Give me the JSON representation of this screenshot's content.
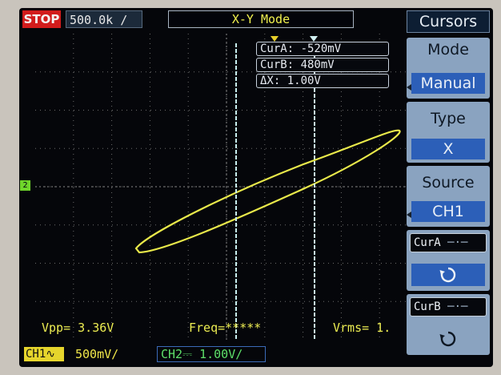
{
  "status": {
    "run_state": "STOP",
    "sample_rate": "500.0k ∕"
  },
  "display": {
    "mode_title": "X-Y    Mode"
  },
  "cursors": {
    "cur_a": "CurA: -520mV",
    "cur_b": "CurB: 480mV",
    "delta": "ΔX: 1.00V"
  },
  "channel_marker": "2",
  "measurements": {
    "vpp": "Vpp= 3.36V",
    "freq": "Freq=*****",
    "vrms": "Vrms= 1."
  },
  "channels": {
    "ch1_label": "CH1∿",
    "ch1_scale": "500mV∕",
    "ch2": "CH2⎓  1.00V∕"
  },
  "menu": {
    "title": "Cursors",
    "mode_label": "Mode",
    "mode_value": "Manual",
    "type_label": "Type",
    "type_value": "X",
    "source_label": "Source",
    "source_value": "CH1",
    "cura_label": "CurA",
    "curb_label": "CurB",
    "knob_icon": "rotate-knob-icon"
  },
  "colors": {
    "trace": "#e9e94a",
    "cursor_line": "#c8eef0",
    "menu_highlight": "#2c5fb8",
    "stop_badge": "#d21c1c"
  }
}
